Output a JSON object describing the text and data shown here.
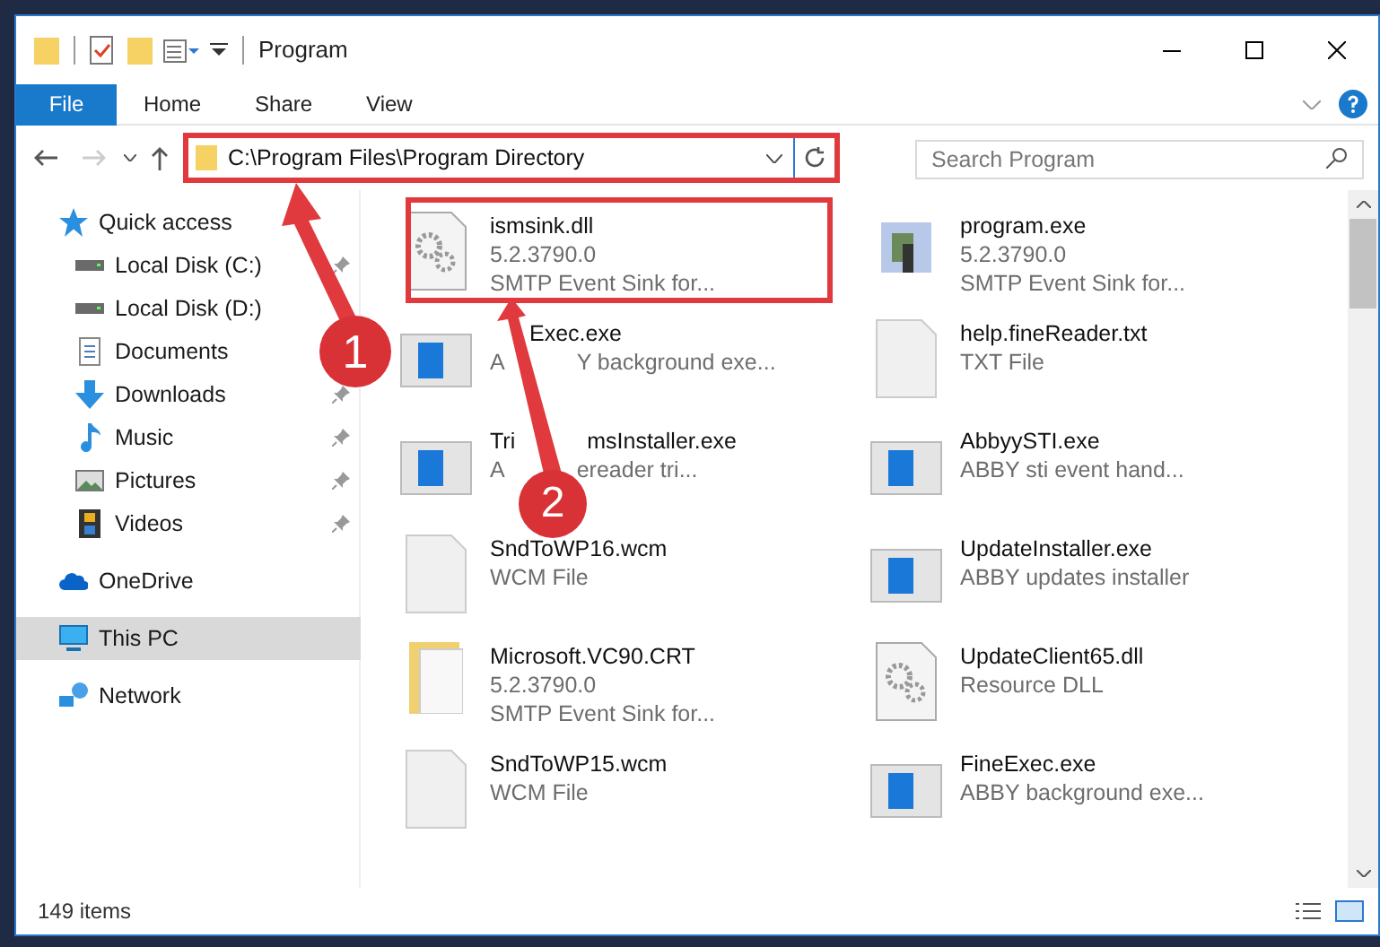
{
  "window": {
    "title": "Program"
  },
  "ribbon_tabs": [
    {
      "label": "File",
      "kind": "file"
    },
    {
      "label": "Home",
      "kind": "tab"
    },
    {
      "label": "Share",
      "kind": "tab"
    },
    {
      "label": "View",
      "kind": "tab"
    }
  ],
  "navigation": {
    "back_disabled": false,
    "forward_disabled": true
  },
  "address": {
    "path": "C:\\Program Files\\Program Directory"
  },
  "search": {
    "placeholder": "Search Program"
  },
  "sidebar": {
    "items": [
      {
        "label": "Quick access",
        "selected": false,
        "children": [
          {
            "label": "Local Disk (C:)",
            "pinned": true
          },
          {
            "label": "Local Disk (D:)",
            "pinned": false
          },
          {
            "label": "Documents",
            "pinned": false
          },
          {
            "label": "Downloads",
            "pinned": true
          },
          {
            "label": "Music",
            "pinned": true
          },
          {
            "label": "Pictures",
            "pinned": true
          },
          {
            "label": "Videos",
            "pinned": true
          }
        ]
      },
      {
        "label": "OneDrive",
        "selected": false
      },
      {
        "label": "This PC",
        "selected": true
      },
      {
        "label": "Network",
        "selected": false
      }
    ]
  },
  "files": [
    {
      "name": [
        "ismsink.dll"
      ],
      "details": [
        [
          "5.2.3790.0"
        ],
        [
          "SMTP Event Sink for..."
        ]
      ],
      "kind": "library"
    },
    {
      "name": [
        "program.exe"
      ],
      "details": [
        [
          "5.2.3790.0"
        ],
        [
          "SMTP Event Sink for..."
        ]
      ],
      "kind": "installer"
    },
    {
      "name": [
        "Exec.exe"
      ],
      "details": [
        [
          "A",
          "Y background exe..."
        ]
      ],
      "kind": "application"
    },
    {
      "name": [
        "help.fineReader.txt"
      ],
      "details": [
        [
          "TXT File"
        ]
      ],
      "kind": "document"
    },
    {
      "name": [
        "Tri",
        "msInstaller.exe"
      ],
      "details": [
        [
          "A",
          "ereader tri..."
        ]
      ],
      "kind": "application"
    },
    {
      "name": [
        "AbbyySTI.exe"
      ],
      "details": [
        [
          "ABBY sti event hand..."
        ]
      ],
      "kind": "application"
    },
    {
      "name": [
        "SndToWP16.wcm"
      ],
      "details": [
        [
          "WCM File"
        ]
      ],
      "kind": "document"
    },
    {
      "name": [
        "UpdateInstaller.exe"
      ],
      "details": [
        [
          "ABBY updates installer"
        ]
      ],
      "kind": "application"
    },
    {
      "name": [
        "Microsoft.VC90.CRT"
      ],
      "details": [
        [
          "5.2.3790.0"
        ],
        [
          "SMTP Event Sink for..."
        ]
      ],
      "kind": "folder"
    },
    {
      "name": [
        "UpdateClient65.dll"
      ],
      "details": [
        [
          "Resource DLL"
        ]
      ],
      "kind": "library"
    },
    {
      "name": [
        "SndToWP15.wcm"
      ],
      "details": [
        [
          "WCM File"
        ]
      ],
      "kind": "document"
    },
    {
      "name": [
        "FineExec.exe"
      ],
      "details": [
        [
          "ABBY background exe..."
        ]
      ],
      "kind": "application"
    }
  ],
  "status_bar": {
    "items": "149 items"
  },
  "annotations": [
    {
      "label": "1"
    },
    {
      "label": "2"
    }
  ]
}
